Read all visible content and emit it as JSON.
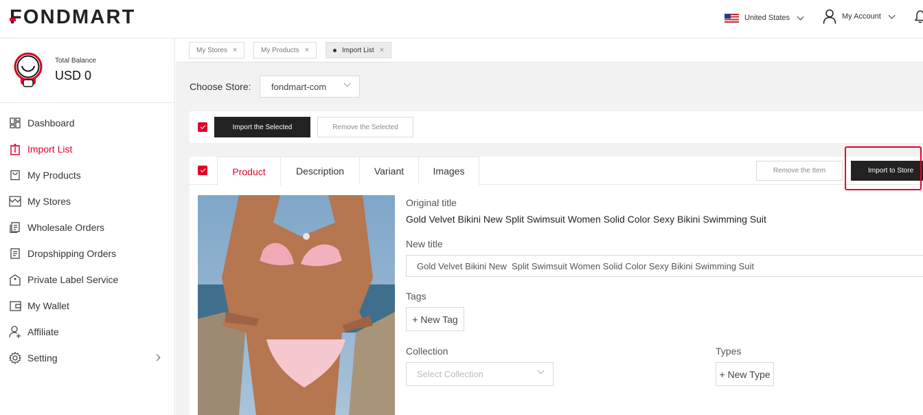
{
  "header": {
    "logo": "FONDMART",
    "country": "United States",
    "account": "My Account"
  },
  "sidebar": {
    "balance_label": "Total Balance",
    "balance_value": "USD 0",
    "items": [
      {
        "label": "Dashboard",
        "icon": "dashboard-icon"
      },
      {
        "label": "Import List",
        "icon": "import-icon",
        "active": true
      },
      {
        "label": "My Products",
        "icon": "bag-icon"
      },
      {
        "label": "My Stores",
        "icon": "store-icon"
      },
      {
        "label": "Wholesale Orders",
        "icon": "orders-icon"
      },
      {
        "label": "Dropshipping Orders",
        "icon": "document-icon"
      },
      {
        "label": "Private Label Service",
        "icon": "tag-icon"
      },
      {
        "label": "My Wallet",
        "icon": "wallet-icon"
      },
      {
        "label": "Affiliate",
        "icon": "add-user-icon"
      },
      {
        "label": "Setting",
        "icon": "gear-icon"
      }
    ]
  },
  "page_tabs": [
    {
      "label": "My Stores"
    },
    {
      "label": "My Products"
    },
    {
      "label": "Import List",
      "active": true
    }
  ],
  "store": {
    "label": "Choose Store:",
    "value": "fondmart-com"
  },
  "actions": {
    "import_selected": "Import the Selected",
    "remove_selected": "Remove the Selected"
  },
  "product_card": {
    "tabs": [
      "Product",
      "Description",
      "Variant",
      "Images"
    ],
    "remove_item": "Remove the Item",
    "import_to_store": "Import to Store",
    "original_title_label": "Original title",
    "original_title": "Gold Velvet Bikini New Split Swimsuit Women Solid Color Sexy Bikini Swimming Suit",
    "new_title_label": "New title",
    "new_title": "Gold Velvet Bikini New  Split Swimsuit Women Solid Color Sexy Bikini Swimming Suit",
    "tags_label": "Tags",
    "new_tag": "+ New Tag",
    "collection_label": "Collection",
    "collection_placeholder": "Select Collection",
    "types_label": "Types",
    "new_type": "+ New Type"
  },
  "colors": {
    "accent": "#e4002b",
    "dark_button": "#222222"
  }
}
